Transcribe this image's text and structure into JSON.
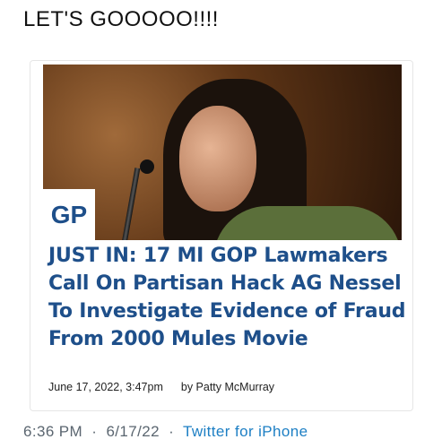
{
  "tweet": {
    "text": "LET'S GOOOOO!!!!",
    "time": "6:36 PM",
    "separator": "·",
    "date": "6/17/22",
    "source": "Twitter for iPhone"
  },
  "card": {
    "badge": "GP",
    "headline_lines": [
      "JUST IN: 17 MI GOP Lawmakers",
      "Call On Partisan Hack AG Nessel",
      "To Investigate Evidence of Fraud",
      "From 2000 Mules Movie"
    ],
    "date": "June 17, 2022, 3:47pm",
    "author": "by Patty McMurray"
  },
  "colors": {
    "headline": "#1e4f8a",
    "link": "#1d7fc4",
    "meta_gray": "#5b6670"
  }
}
